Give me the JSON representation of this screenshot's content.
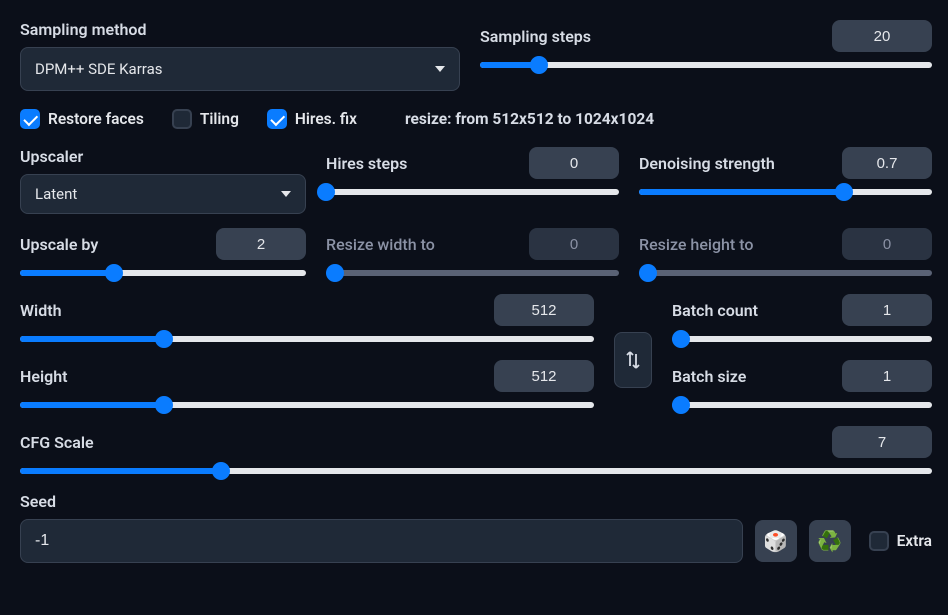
{
  "sampling": {
    "method_label": "Sampling method",
    "method_value": "DPM++ SDE Karras",
    "steps_label": "Sampling steps",
    "steps_value": "20",
    "steps_pct": 13
  },
  "checks": {
    "restore_label": "Restore faces",
    "restore": true,
    "tiling_label": "Tiling",
    "tiling": false,
    "hires_label": "Hires. fix",
    "hires": true,
    "resize_text": "resize: from 512x512 to 1024x1024"
  },
  "hires": {
    "upscaler_label": "Upscaler",
    "upscaler_value": "Latent",
    "steps_label": "Hires steps",
    "steps_value": "0",
    "steps_pct": 0,
    "denoise_label": "Denoising strength",
    "denoise_value": "0.7",
    "denoise_pct": 70,
    "upscale_by_label": "Upscale by",
    "upscale_by_value": "2",
    "upscale_by_pct": 33,
    "resize_w_label": "Resize width to",
    "resize_w_value": "0",
    "resize_h_label": "Resize height to",
    "resize_h_value": "0"
  },
  "dims": {
    "width_label": "Width",
    "width_value": "512",
    "width_pct": 25,
    "height_label": "Height",
    "height_value": "512",
    "height_pct": 25
  },
  "batch": {
    "count_label": "Batch count",
    "count_value": "1",
    "count_pct": 1,
    "size_label": "Batch size",
    "size_value": "1",
    "size_pct": 1
  },
  "cfg": {
    "label": "CFG Scale",
    "value": "7",
    "pct": 22
  },
  "seed": {
    "label": "Seed",
    "value": "-1",
    "extra_label": "Extra",
    "extra": false
  }
}
